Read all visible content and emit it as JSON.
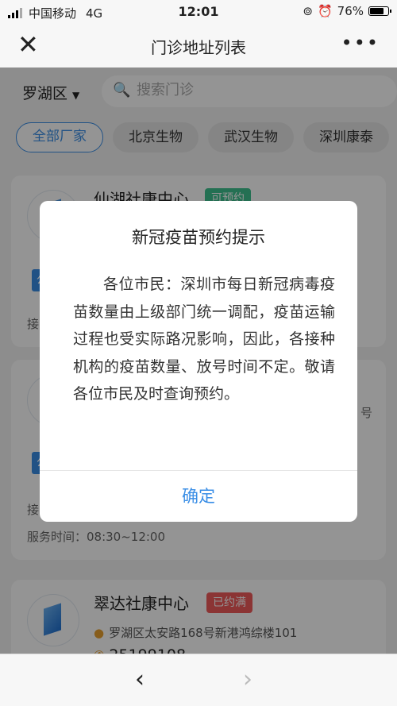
{
  "status_bar": {
    "carrier": "中国移动",
    "network": "4G",
    "time": "12:01",
    "battery": "76%",
    "battery_level": 0.76
  },
  "nav": {
    "title": "门诊地址列表",
    "close_icon": "close-icon",
    "more_icon": "more-icon"
  },
  "filter": {
    "district": "罗湖区",
    "search_placeholder": "搜索门诊"
  },
  "chips": [
    "全部厂家",
    "北京生物",
    "武汉生物",
    "深圳康泰"
  ],
  "cards": [
    {
      "name": "仙湖社康中心",
      "badge": "可预约",
      "tag": "公",
      "label_prefix": "接"
    },
    {
      "tag": "公",
      "label_prefix": "接",
      "hours_label": "服务时间：08:30~12:00",
      "side_text": "号"
    },
    {
      "name": "翠达社康中心",
      "badge": "已约满",
      "address": "罗湖区太安路168号新港鸿综楼101",
      "phone": "25199108"
    }
  ],
  "modal": {
    "title": "新冠疫苗预约提示",
    "body": "各位市民：深圳市每日新冠病毒疫苗数量由上级部门统一调配，疫苗运输过程也受实际路况影响，因此，各接种机构的疫苗数量、放号时间不定。敬请各位市民及时查询预约。",
    "confirm": "确定"
  },
  "bottom_bar": {
    "back": "‹",
    "forward": "›"
  },
  "colors": {
    "accent": "#3a8ee6",
    "ok": "#3ec28f",
    "full": "#ef5a5a"
  }
}
